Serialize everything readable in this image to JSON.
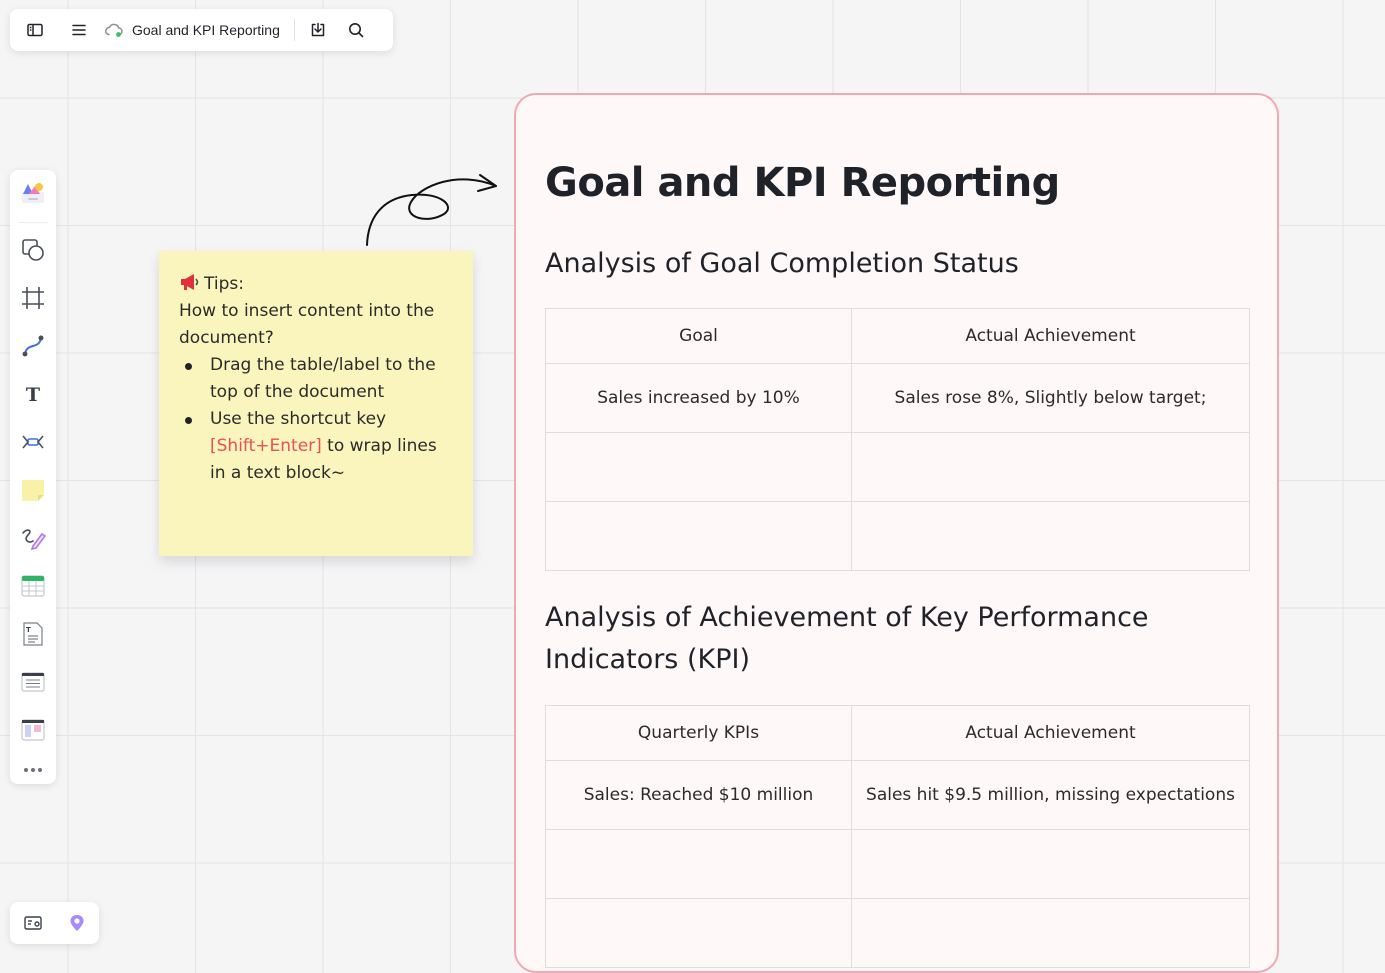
{
  "topbar": {
    "title": "Goal and KPI Reporting",
    "sync_color": "#34c26b"
  },
  "sidebar": {
    "items": [
      {
        "name": "template-icon"
      },
      {
        "name": "shape-icon"
      },
      {
        "name": "frame-icon"
      },
      {
        "name": "connector-icon"
      },
      {
        "name": "text-icon"
      },
      {
        "name": "mindmap-icon"
      },
      {
        "name": "sticky-note-icon"
      },
      {
        "name": "pen-icon"
      },
      {
        "name": "table-icon"
      },
      {
        "name": "document-icon"
      },
      {
        "name": "list-icon"
      },
      {
        "name": "kanban-icon"
      },
      {
        "name": "more-icon"
      }
    ]
  },
  "sticky_note": {
    "tips_label": "Tips:",
    "question": "How to insert content into the document?",
    "bullet1": "Drag the table/label to the top of the document",
    "bullet2_before": "Use the shortcut key ",
    "bullet2_shortcut": "[Shift+Enter]",
    "bullet2_after": " to wrap lines in a text block~",
    "background": "#f9f5bd",
    "shortcut_color": "#e8505b"
  },
  "document": {
    "title": "Goal and KPI Reporting",
    "border_color": "#f3a7b4",
    "section1": {
      "heading": "Analysis of Goal Completion Status",
      "headers": [
        "Goal",
        "Actual Achievement"
      ],
      "rows": [
        [
          "Sales increased by 10%",
          "Sales rose 8%, Slightly below target;"
        ],
        [
          "",
          ""
        ],
        [
          "",
          ""
        ]
      ]
    },
    "section2": {
      "heading": "Analysis of Achievement of Key Performance Indicators (KPI)",
      "headers": [
        "Quarterly KPIs",
        "Actual Achievement"
      ],
      "rows": [
        [
          "Sales: Reached $10 million",
          "Sales hit $9.5 million, missing expectations"
        ],
        [
          "",
          ""
        ],
        [
          "",
          ""
        ]
      ]
    }
  }
}
